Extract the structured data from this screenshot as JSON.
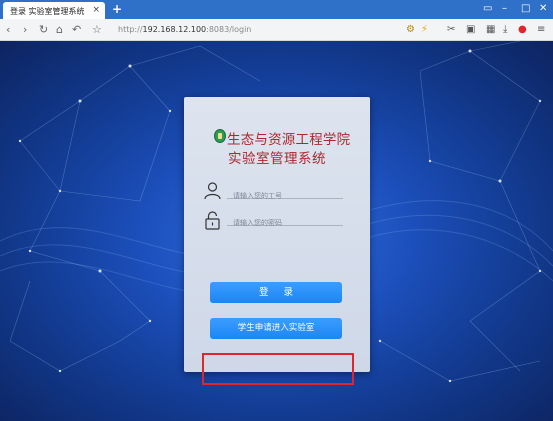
{
  "browser": {
    "tab_title": "登录 实验室管理系统",
    "tab_close": "×",
    "new_tab": "+",
    "url_prefix": "http://",
    "url_host": "192.168.12.100",
    "url_rest": ":8083/login"
  },
  "login": {
    "title_line1": "生态与资源工程学院",
    "title_line2": "实验室管理系统",
    "username_placeholder": "请输入您的工号",
    "password_placeholder": "请输入您的密码",
    "login_button": "登 录",
    "apply_button": "学生申请进入实验室"
  },
  "colors": {
    "title": "#b0262c",
    "button": "#1a86f5",
    "highlight": "#e0262a"
  }
}
